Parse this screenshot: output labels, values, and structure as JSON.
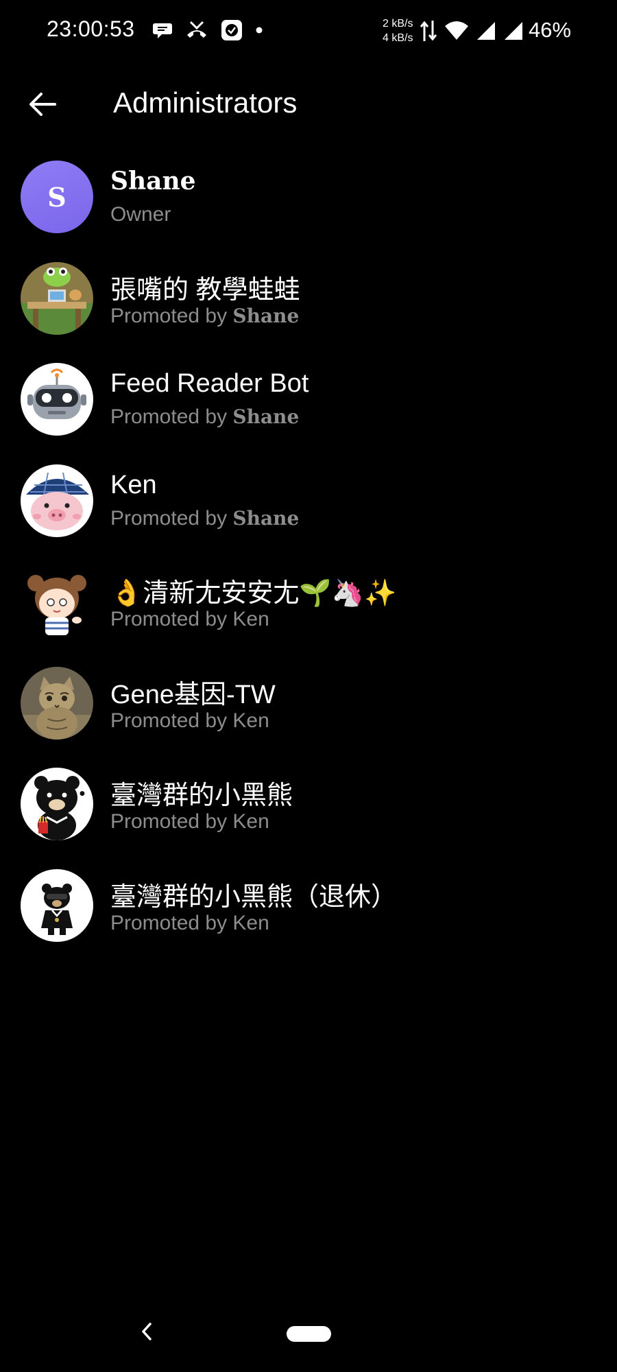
{
  "status_bar": {
    "time": "23:00:53",
    "notification_icons": [
      "chat-bubble-icon",
      "missed-call-icon",
      "app-icon",
      "dot-icon"
    ],
    "net_speed_up": "2 kB/s",
    "net_speed_down": "4 kB/s",
    "right_icons": [
      "data-arrows-icon",
      "wifi-icon",
      "signal-icon",
      "signal-icon"
    ],
    "battery": "46%"
  },
  "header": {
    "title": "Administrators",
    "back_icon": "arrow-left-icon"
  },
  "admins": [
    {
      "name": "Shane",
      "role_prefix": "Owner",
      "promoter": "",
      "avatar_letter": "S",
      "avatar_color": "#8572f0"
    },
    {
      "name": "張嘴的 教學蛙蛙",
      "role_prefix": "Promoted by ",
      "promoter": "Shane",
      "avatar_icon": "frog-avatar"
    },
    {
      "name": "Feed Reader Bot",
      "role_prefix": "Promoted by ",
      "promoter": "Shane",
      "avatar_icon": "robot-avatar"
    },
    {
      "name": "Ken",
      "role_prefix": "Promoted by ",
      "promoter": "Shane",
      "avatar_icon": "pig-avatar"
    },
    {
      "name": "👌清新尢安安尢🌱🦄✨",
      "role_prefix": "Promoted by ",
      "promoter": "Ken",
      "avatar_icon": "cartoon-girl-avatar"
    },
    {
      "name": "Gene基因-TW",
      "role_prefix": "Promoted by ",
      "promoter": "Ken",
      "avatar_icon": "cat-avatar"
    },
    {
      "name": "臺灣群的小黑熊",
      "role_prefix": "Promoted by ",
      "promoter": "Ken",
      "avatar_icon": "black-bear-avatar"
    },
    {
      "name": "臺灣群的小黑熊（退休）",
      "role_prefix": "Promoted by ",
      "promoter": "Ken",
      "avatar_icon": "retired-bear-avatar"
    }
  ],
  "colors": {
    "background": "#000000",
    "text_primary": "#ffffff",
    "text_secondary": "#8d8d8d"
  }
}
